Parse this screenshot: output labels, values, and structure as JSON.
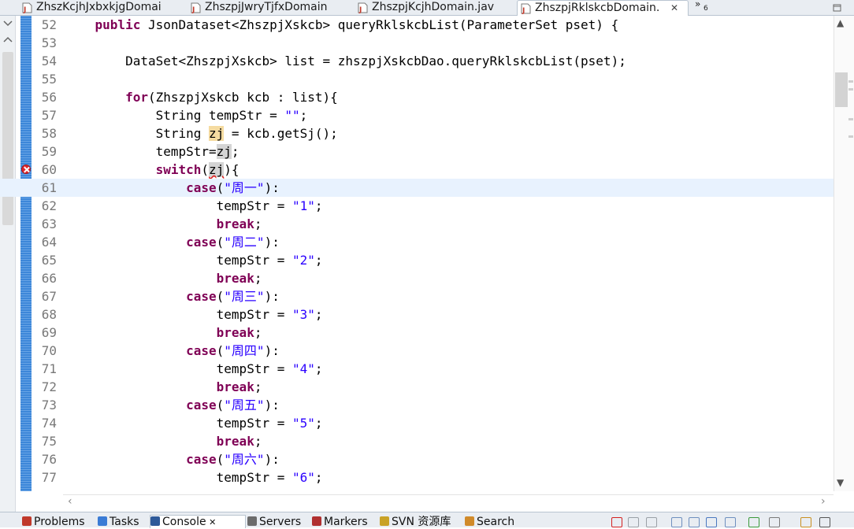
{
  "editor_tabs": [
    {
      "label": "ZhszKcjhJxbxkjgDomai",
      "active": false
    },
    {
      "label": "ZhszpjJwryTjfxDomain",
      "active": false
    },
    {
      "label": "ZhszpjKcjhDomain.jav",
      "active": false
    },
    {
      "label": "ZhszpjRklskcbDomain.",
      "active": true,
      "close": "✕"
    }
  ],
  "tab_overflow": {
    "symbol": "»",
    "count": "6"
  },
  "code_lines": [
    {
      "num": "52",
      "tokens": [
        {
          "t": "    ",
          "c": ""
        },
        {
          "t": "public",
          "c": "kw"
        },
        {
          "t": " JsonDataset<ZhszpjXskcb> queryRklskcbList(ParameterSet pset) {",
          "c": ""
        }
      ]
    },
    {
      "num": "53",
      "tokens": []
    },
    {
      "num": "54",
      "tokens": [
        {
          "t": "        DataSet<ZhszpjXskcb> list = zhszpjXskcbDao.queryRklskcbList(pset);",
          "c": ""
        }
      ]
    },
    {
      "num": "55",
      "tokens": []
    },
    {
      "num": "56",
      "tokens": [
        {
          "t": "        ",
          "c": ""
        },
        {
          "t": "for",
          "c": "kw"
        },
        {
          "t": "(ZhszpjXskcb kcb : list){",
          "c": ""
        }
      ]
    },
    {
      "num": "57",
      "tokens": [
        {
          "t": "            String tempStr = ",
          "c": ""
        },
        {
          "t": "\"\"",
          "c": "str"
        },
        {
          "t": ";",
          "c": ""
        }
      ]
    },
    {
      "num": "58",
      "tokens": [
        {
          "t": "            String ",
          "c": ""
        },
        {
          "t": "zj",
          "c": "occ-w"
        },
        {
          "t": " = kcb.getSj();",
          "c": ""
        }
      ]
    },
    {
      "num": "59",
      "tokens": [
        {
          "t": "            tempStr=",
          "c": ""
        },
        {
          "t": "zj",
          "c": "occ-r"
        },
        {
          "t": ";",
          "c": ""
        }
      ]
    },
    {
      "num": "60",
      "error": true,
      "tokens": [
        {
          "t": "            ",
          "c": ""
        },
        {
          "t": "switch",
          "c": "kw"
        },
        {
          "t": "(",
          "c": ""
        },
        {
          "t": "zj",
          "c": "occ-r err"
        },
        {
          "t": "){",
          "c": ""
        }
      ]
    },
    {
      "num": "61",
      "current": true,
      "tokens": [
        {
          "t": "                ",
          "c": ""
        },
        {
          "t": "case",
          "c": "kw"
        },
        {
          "t": "(",
          "c": ""
        },
        {
          "t": "\"周一\"",
          "c": "str"
        },
        {
          "t": "):",
          "c": ""
        }
      ]
    },
    {
      "num": "62",
      "tokens": [
        {
          "t": "                    tempStr = ",
          "c": ""
        },
        {
          "t": "\"1\"",
          "c": "str"
        },
        {
          "t": ";",
          "c": ""
        }
      ]
    },
    {
      "num": "63",
      "tokens": [
        {
          "t": "                    ",
          "c": ""
        },
        {
          "t": "break",
          "c": "kw"
        },
        {
          "t": ";",
          "c": ""
        }
      ]
    },
    {
      "num": "64",
      "tokens": [
        {
          "t": "                ",
          "c": ""
        },
        {
          "t": "case",
          "c": "kw"
        },
        {
          "t": "(",
          "c": ""
        },
        {
          "t": "\"周二\"",
          "c": "str"
        },
        {
          "t": "):",
          "c": ""
        }
      ]
    },
    {
      "num": "65",
      "tokens": [
        {
          "t": "                    tempStr = ",
          "c": ""
        },
        {
          "t": "\"2\"",
          "c": "str"
        },
        {
          "t": ";",
          "c": ""
        }
      ]
    },
    {
      "num": "66",
      "tokens": [
        {
          "t": "                    ",
          "c": ""
        },
        {
          "t": "break",
          "c": "kw"
        },
        {
          "t": ";",
          "c": ""
        }
      ]
    },
    {
      "num": "67",
      "tokens": [
        {
          "t": "                ",
          "c": ""
        },
        {
          "t": "case",
          "c": "kw"
        },
        {
          "t": "(",
          "c": ""
        },
        {
          "t": "\"周三\"",
          "c": "str"
        },
        {
          "t": "):",
          "c": ""
        }
      ]
    },
    {
      "num": "68",
      "tokens": [
        {
          "t": "                    tempStr = ",
          "c": ""
        },
        {
          "t": "\"3\"",
          "c": "str"
        },
        {
          "t": ";",
          "c": ""
        }
      ]
    },
    {
      "num": "69",
      "tokens": [
        {
          "t": "                    ",
          "c": ""
        },
        {
          "t": "break",
          "c": "kw"
        },
        {
          "t": ";",
          "c": ""
        }
      ]
    },
    {
      "num": "70",
      "tokens": [
        {
          "t": "                ",
          "c": ""
        },
        {
          "t": "case",
          "c": "kw"
        },
        {
          "t": "(",
          "c": ""
        },
        {
          "t": "\"周四\"",
          "c": "str"
        },
        {
          "t": "):",
          "c": ""
        }
      ]
    },
    {
      "num": "71",
      "tokens": [
        {
          "t": "                    tempStr = ",
          "c": ""
        },
        {
          "t": "\"4\"",
          "c": "str"
        },
        {
          "t": ";",
          "c": ""
        }
      ]
    },
    {
      "num": "72",
      "tokens": [
        {
          "t": "                    ",
          "c": ""
        },
        {
          "t": "break",
          "c": "kw"
        },
        {
          "t": ";",
          "c": ""
        }
      ]
    },
    {
      "num": "73",
      "tokens": [
        {
          "t": "                ",
          "c": ""
        },
        {
          "t": "case",
          "c": "kw"
        },
        {
          "t": "(",
          "c": ""
        },
        {
          "t": "\"周五\"",
          "c": "str"
        },
        {
          "t": "):",
          "c": ""
        }
      ]
    },
    {
      "num": "74",
      "tokens": [
        {
          "t": "                    tempStr = ",
          "c": ""
        },
        {
          "t": "\"5\"",
          "c": "str"
        },
        {
          "t": ";",
          "c": ""
        }
      ]
    },
    {
      "num": "75",
      "tokens": [
        {
          "t": "                    ",
          "c": ""
        },
        {
          "t": "break",
          "c": "kw"
        },
        {
          "t": ";",
          "c": ""
        }
      ]
    },
    {
      "num": "76",
      "tokens": [
        {
          "t": "                ",
          "c": ""
        },
        {
          "t": "case",
          "c": "kw"
        },
        {
          "t": "(",
          "c": ""
        },
        {
          "t": "\"周六\"",
          "c": "str"
        },
        {
          "t": "):",
          "c": ""
        }
      ]
    },
    {
      "num": "77",
      "tokens": [
        {
          "t": "                    tempStr = ",
          "c": ""
        },
        {
          "t": "\"6\"",
          "c": "str"
        },
        {
          "t": ";",
          "c": ""
        }
      ]
    }
  ],
  "bottom_tabs": [
    {
      "label": "Problems",
      "icon": "problems-icon",
      "color": "#c0392b"
    },
    {
      "label": "Tasks",
      "icon": "tasks-icon",
      "color": "#3a7bd5"
    },
    {
      "label": "Console",
      "icon": "console-icon",
      "color": "#2e5a99",
      "active": true,
      "close": "✕"
    },
    {
      "label": "Servers",
      "icon": "servers-icon",
      "color": "#6b6b6b"
    },
    {
      "label": "Markers",
      "icon": "markers-icon",
      "color": "#b03030"
    },
    {
      "label": "SVN 资源库",
      "icon": "svn-repository-icon",
      "color": "#c9a227"
    },
    {
      "label": "Search",
      "icon": "search-icon",
      "color": "#d08a2a"
    }
  ],
  "colors": {
    "keyword": "#7f0055",
    "string": "#2a00ff",
    "current_line": "#e8f2fe",
    "error": "#e0242a",
    "gutter": "#3d87d9"
  }
}
